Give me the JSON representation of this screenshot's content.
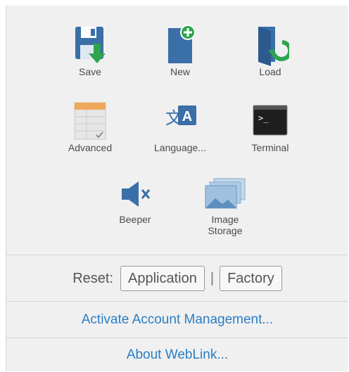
{
  "tools": {
    "save": {
      "label": "Save"
    },
    "new": {
      "label": "New"
    },
    "load": {
      "label": "Load"
    },
    "advanced": {
      "label": "Advanced"
    },
    "language": {
      "label": "Language..."
    },
    "terminal": {
      "label": "Terminal"
    },
    "beeper": {
      "label": "Beeper"
    },
    "image_storage": {
      "label_line1": "Image",
      "label_line2": "Storage"
    }
  },
  "reset": {
    "label": "Reset:",
    "application_button": "Application",
    "separator": "|",
    "factory_button": "Factory"
  },
  "links": {
    "activate_account": "Activate Account Management...",
    "about": "About WebLink..."
  },
  "colors": {
    "icon_blue": "#3a6fa8",
    "accent_green": "#2da44e",
    "link_blue": "#2a7ec4",
    "panel_bg": "#f0f0f0"
  }
}
